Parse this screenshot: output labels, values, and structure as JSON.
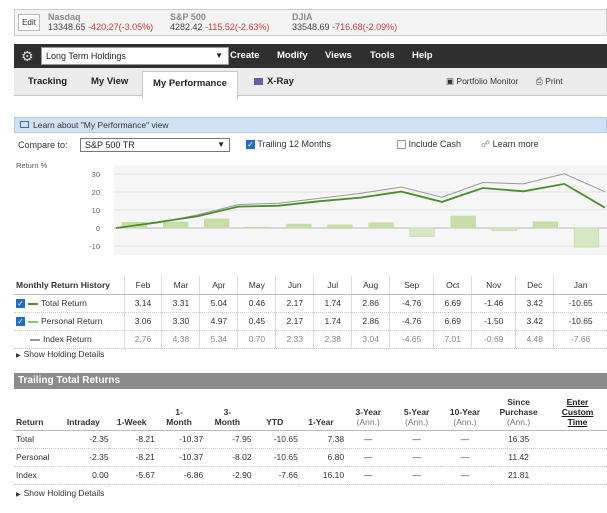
{
  "ticker": {
    "edit_label": "Edit",
    "items": [
      {
        "name": "Nasdaq",
        "value": "13348.65",
        "change": "-420.27(-3.05%)"
      },
      {
        "name": "S&P 500",
        "value": "4282.42",
        "change": "-115.52(-2.63%)"
      },
      {
        "name": "DJIA",
        "value": "33548.69",
        "change": "-716.68(-2.09%)"
      }
    ]
  },
  "toolbar": {
    "portfolio_select": "Long Term Holdings",
    "menus": [
      "Create",
      "Modify",
      "Views",
      "Tools",
      "Help"
    ]
  },
  "tabs": {
    "items": [
      "Tracking",
      "My View",
      "My Performance",
      "X-Ray"
    ],
    "active": "My Performance",
    "portfolio_monitor": "Portfolio Monitor",
    "print": "Print"
  },
  "learn_bar": {
    "text": "Learn about \"My Performance\" view"
  },
  "compare": {
    "label": "Compare to:",
    "selected": "S&P 500 TR",
    "trailing_label": "Trailing 12 Months",
    "trailing_checked": true,
    "include_cash_label": "Include Cash",
    "include_cash_checked": false,
    "learn_more": "Learn more"
  },
  "colors": {
    "total_line": "#4c8c2b",
    "index_line": "#999999",
    "bar_pos": "#c7dea8",
    "bar_neg": "#d5e8c2",
    "header_bar": "#8c8c8c",
    "change_red": "#d23a3a"
  },
  "chart_data": {
    "type": "bar",
    "ylabel": "Return %",
    "ylim": [
      -15,
      35
    ],
    "yticks": [
      30,
      20,
      10,
      0,
      -10
    ],
    "categories": [
      "Feb",
      "Mar",
      "Apr",
      "May",
      "Jun",
      "Jul",
      "Aug",
      "Sep",
      "Oct",
      "Nov",
      "Dec",
      "Jan"
    ],
    "series": [
      {
        "name": "Total Return",
        "values": [
          3.14,
          3.31,
          5.04,
          0.46,
          2.17,
          1.74,
          2.86,
          -4.76,
          6.69,
          -1.46,
          3.42,
          -10.65
        ]
      },
      {
        "name": "Personal Return",
        "values": [
          3.06,
          3.3,
          4.97,
          0.45,
          2.17,
          1.74,
          2.86,
          -4.76,
          6.69,
          -1.5,
          3.42,
          -10.65
        ]
      },
      {
        "name": "Index Return",
        "values": [
          2.76,
          4.38,
          5.34,
          0.7,
          2.33,
          2.38,
          3.04,
          -4.65,
          7.01,
          -0.69,
          4.48,
          -7.66
        ]
      }
    ],
    "cumulative_lines": {
      "portfolio": [
        0,
        3.1,
        6.5,
        11.9,
        12.4,
        14.9,
        16.9,
        20.2,
        14.5,
        22.2,
        20.4,
        24.5,
        11.3
      ],
      "index": [
        0,
        2.8,
        7.3,
        13.0,
        13.8,
        16.5,
        19.2,
        22.8,
        17.1,
        25.3,
        24.5,
        30.1,
        20.1
      ]
    }
  },
  "monthly": {
    "title": "Monthly Return History",
    "months": [
      "Feb",
      "Mar",
      "Apr",
      "May",
      "Jun",
      "Jul",
      "Aug",
      "Sep",
      "Oct",
      "Nov",
      "Dec",
      "Jan"
    ],
    "rows": [
      {
        "label": "Total Return",
        "values": [
          "3.14",
          "3.31",
          "5.04",
          "0.46",
          "2.17",
          "1.74",
          "2.86",
          "-4.76",
          "6.69",
          "-1.46",
          "3.42",
          "-10.65"
        ]
      },
      {
        "label": "Personal Return",
        "values": [
          "3.06",
          "3.30",
          "4.97",
          "0.45",
          "2.17",
          "1.74",
          "2.86",
          "-4.76",
          "6.69",
          "-1.50",
          "3.42",
          "-10.65"
        ]
      },
      {
        "label": "Index Return",
        "values": [
          "2.76",
          "4.38",
          "5.34",
          "0.70",
          "2.33",
          "2.38",
          "3.04",
          "-4.65",
          "7.01",
          "-0.69",
          "4.48",
          "-7.66"
        ]
      }
    ],
    "show_details": "Show Holding Details"
  },
  "trailing": {
    "title": "Trailing Total Returns",
    "headers": [
      {
        "l1": "",
        "l2": "",
        "l3": "Return",
        "sub": ""
      },
      {
        "l1": "",
        "l2": "",
        "l3": "Intraday",
        "sub": ""
      },
      {
        "l1": "",
        "l2": "",
        "l3": "1-Week",
        "sub": ""
      },
      {
        "l1": "",
        "l2": "1-",
        "l3": "Month",
        "sub": ""
      },
      {
        "l1": "",
        "l2": "3-",
        "l3": "Month",
        "sub": ""
      },
      {
        "l1": "",
        "l2": "",
        "l3": "YTD",
        "sub": ""
      },
      {
        "l1": "",
        "l2": "",
        "l3": "1-Year",
        "sub": ""
      },
      {
        "l1": "",
        "l2": "3-Year",
        "l3": "(Ann.)",
        "sub": ""
      },
      {
        "l1": "",
        "l2": "5-Year",
        "l3": "(Ann.)",
        "sub": ""
      },
      {
        "l1": "",
        "l2": "10-Year",
        "l3": "(Ann.)",
        "sub": ""
      },
      {
        "l1": "Since",
        "l2": "Purchase",
        "l3": "(Ann.)",
        "sub": ""
      },
      {
        "l1": "Enter",
        "l2": "Custom",
        "l3": "Time",
        "sub": ""
      }
    ],
    "rows": [
      {
        "label": "Total",
        "values": [
          "-2.35",
          "-8.21",
          "-10.37",
          "-7.95",
          "-10.65",
          "7.38",
          "—",
          "—",
          "—",
          "16.35",
          ""
        ]
      },
      {
        "label": "Personal",
        "values": [
          "-2.35",
          "-8.21",
          "-10.37",
          "-8.02",
          "-10.65",
          "6.80",
          "—",
          "—",
          "—",
          "11.42",
          ""
        ]
      },
      {
        "label": "Index",
        "values": [
          "0.00",
          "-5.67",
          "-6.86",
          "-2.90",
          "-7.66",
          "16.10",
          "—",
          "—",
          "—",
          "21.81",
          ""
        ]
      }
    ],
    "show_details": "Show Holding Details"
  }
}
